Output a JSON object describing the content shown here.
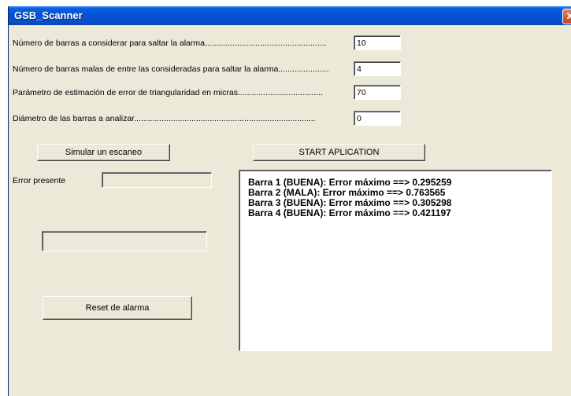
{
  "window": {
    "title": "GSB_Scanner",
    "close_glyph": "✕"
  },
  "params": [
    {
      "label": "Número de barras a considerar para saltar la alarma.....................................................",
      "value": "10"
    },
    {
      "label": "Número de barras malas de entre las consideradas para saltar la alarma......................",
      "value": "4"
    },
    {
      "label": "Parámetro de estimación de error de triangularidad en micras.....................................",
      "value": "70"
    },
    {
      "label": "Diámetro de las barras a analizar...............................................................................",
      "value": "0"
    }
  ],
  "buttons": {
    "simulate": "Simular un escaneo",
    "start": "START APLICATION",
    "reset": "Reset de alarma"
  },
  "error_label": "Error presente",
  "log": [
    "Barra 1 (BUENA): Error máximo ==> 0.295259",
    "Barra 2 (MALA): Error máximo ==> 0.763565",
    "Barra 3 (BUENA): Error máximo ==> 0.305298",
    "Barra 4 (BUENA): Error máximo ==> 0.421197"
  ]
}
